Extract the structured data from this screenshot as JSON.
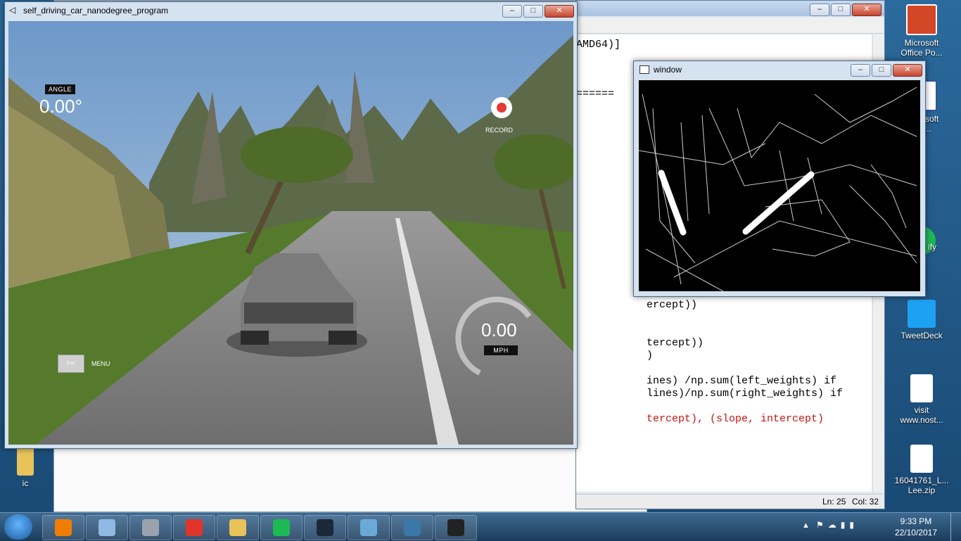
{
  "desktop": {
    "icons": [
      {
        "label_1": "Microsoft",
        "label_2": "Office Po...",
        "icon": "powerpoint-icon",
        "color": "#d24726"
      },
      {
        "label_1": "Microsoft",
        "label_2": "Wo...",
        "icon": "word-icon",
        "color": "#2b579a"
      },
      {
        "label_1": "ify",
        "label_2": "",
        "icon": "spotify-icon",
        "color": "#1db954"
      },
      {
        "label_1": "TweetDeck",
        "label_2": "",
        "icon": "tweetdeck-icon",
        "color": "#1da1f2"
      },
      {
        "label_1": "visit",
        "label_2": "www.nost...",
        "icon": "shortcut-file-icon",
        "color": "#ffffff"
      },
      {
        "label_1": "16041761_L...",
        "label_2": "Lee.zip",
        "icon": "zip-file-icon",
        "color": "#ffffff"
      },
      {
        "label_1": "ic",
        "label_2": "",
        "icon": "folder-icon",
        "color": "#e8c35a"
      }
    ]
  },
  "editor": {
    "title_fragment": "AMD64)]",
    "separator": "======",
    "lines": [
      {
        "text": "ercept))",
        "color": "#000000"
      },
      {
        "text": "tercept))",
        "color": "#000000"
      },
      {
        "text": ")",
        "color": "#000000"
      },
      {
        "text": "ines) /np.sum(left_weights) if",
        "color": "#000000"
      },
      {
        "text": "lines)/np.sum(right_weights) if",
        "color": "#000000"
      },
      {
        "text": "tercept), (slope, intercept)",
        "color": "#cc1111"
      }
    ],
    "status_ln": "Ln: 25",
    "status_col": "Col: 32"
  },
  "unity_window": {
    "title": "self_driving_car_nanodegree_program",
    "hud": {
      "angle_label": "ANGLE",
      "angle_value": "0.00°",
      "record_label": "RECORD",
      "speed_value": "0.00",
      "speed_unit": "MPH",
      "esc_label": "ESC",
      "menu_label": "MENU"
    },
    "record_color": "#e53935"
  },
  "cv_window": {
    "title": "window"
  },
  "taskbar": {
    "apps": [
      {
        "icon": "media-player-icon",
        "color": "#f07d00"
      },
      {
        "icon": "image-viewer-icon",
        "color": "#8fb9e2"
      },
      {
        "icon": "scanner-icon",
        "color": "#9aa3ad"
      },
      {
        "icon": "chrome-icon",
        "color": "#e0342a"
      },
      {
        "icon": "file-explorer-icon",
        "color": "#e8c35a"
      },
      {
        "icon": "spotify-icon",
        "color": "#1db954"
      },
      {
        "icon": "steam-icon",
        "color": "#1b2838"
      },
      {
        "icon": "paint-icon",
        "color": "#6aa9d8"
      },
      {
        "icon": "python-icon",
        "color": "#3b77a8"
      },
      {
        "icon": "unity-icon",
        "color": "#222222"
      }
    ],
    "time": "9:33 PM",
    "date": "22/10/2017"
  }
}
